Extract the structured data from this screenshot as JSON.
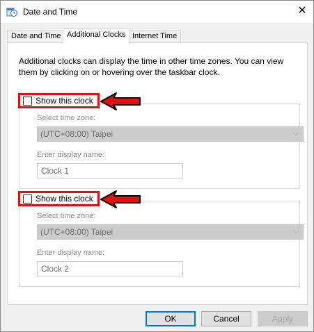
{
  "window": {
    "title": "Date and Time",
    "icon": "date-time-icon",
    "close_glyph": "✕"
  },
  "tabs": [
    {
      "label": "Date and Time",
      "active": false
    },
    {
      "label": "Additional Clocks",
      "active": true
    },
    {
      "label": "Internet Time",
      "active": false
    }
  ],
  "panel": {
    "intro_line1": "Additional clocks can display the time in other time zones. You can view",
    "intro_line2": "them by clicking on or hovering over the taskbar clock.",
    "clocks": [
      {
        "checkbox_label": "Show this clock",
        "checked": false,
        "timezone_label": "Select time zone:",
        "timezone_value": "(UTC+08:00) Taipei",
        "name_label": "Enter display name:",
        "name_value": "Clock 1"
      },
      {
        "checkbox_label": "Show this clock",
        "checked": false,
        "timezone_label": "Select time zone:",
        "timezone_value": "(UTC+08:00) Taipei",
        "name_label": "Enter display name:",
        "name_value": "Clock 2"
      }
    ]
  },
  "buttons": {
    "ok": "OK",
    "cancel": "Cancel",
    "apply": "Apply"
  },
  "colors": {
    "highlight": "#e31010",
    "accent": "#0078d7"
  }
}
